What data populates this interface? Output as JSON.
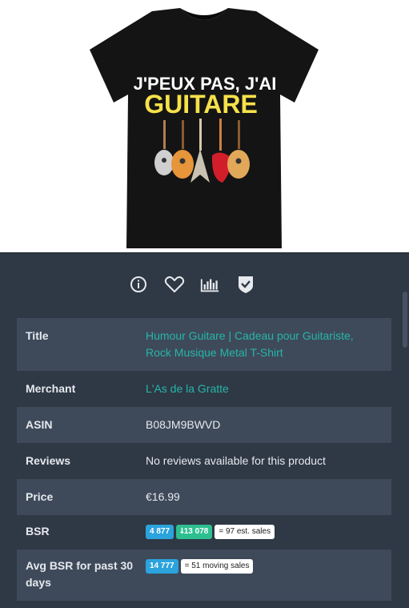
{
  "product": {
    "shirt_text_line1": "J'PEUX PAS, J'AI",
    "shirt_text_line2": "GUITARE"
  },
  "icons": [
    "info-icon",
    "heart-icon",
    "bar-chart-icon",
    "shield-check-icon"
  ],
  "details": {
    "title_label": "Title",
    "title_value": "Humour Guitare | Cadeau pour Guitariste, Rock Musique Metal T-Shirt",
    "merchant_label": "Merchant",
    "merchant_value": "L'As de la Gratte",
    "asin_label": "ASIN",
    "asin_value": "B08JM9BWVD",
    "reviews_label": "Reviews",
    "reviews_value": "No reviews available for this product",
    "price_label": "Price",
    "price_value": "€16.99",
    "bsr_label": "BSR",
    "bsr_rank": "4 877",
    "bsr_change": "⭣13 078",
    "bsr_sales": "= 97 est. sales",
    "avg_label": "Avg BSR for past 30 days",
    "avg_rank": "14 777",
    "avg_sales": "= 51 moving sales"
  },
  "colors": {
    "panel_bg": "#2f3845",
    "row_alt_bg": "#3e4a5a",
    "link": "#27b5a8",
    "badge_blue": "#2ba3dc",
    "badge_green": "#2dbf8f"
  }
}
